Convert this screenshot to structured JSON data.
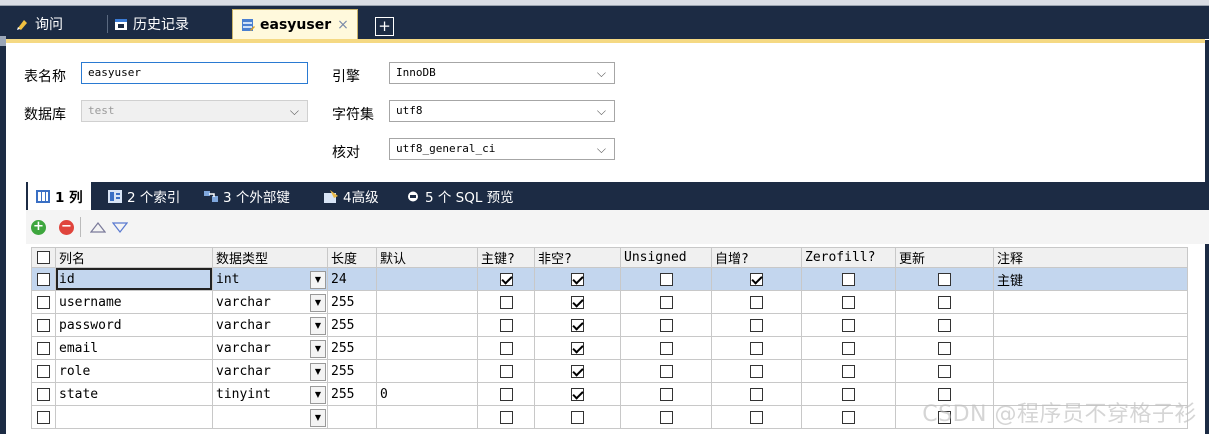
{
  "tabs": [
    {
      "label": "询问",
      "icon": "query-icon"
    },
    {
      "label": "历史记录",
      "icon": "history-icon"
    },
    {
      "label": "easyuser",
      "icon": "table-design-icon",
      "close": "×"
    }
  ],
  "tab_add": "+",
  "form": {
    "table_name_label": "表名称",
    "table_name_value": "easyuser",
    "database_label": "数据库",
    "database_value": "test",
    "engine_label": "引擎",
    "engine_value": "InnoDB",
    "charset_label": "字符集",
    "charset_value": "utf8",
    "collation_label": "核对",
    "collation_value": "utf8_general_ci"
  },
  "subtabs": [
    {
      "label": "1 列",
      "icon": "columns-icon"
    },
    {
      "label": "2 个索引",
      "icon": "index-icon"
    },
    {
      "label": "3 个外部键",
      "icon": "foreign-key-icon"
    },
    {
      "label": "4高级",
      "icon": "advanced-icon"
    },
    {
      "label": "5 个 SQL 预览",
      "icon": "sql-preview-icon"
    }
  ],
  "grid": {
    "headers": [
      "列名",
      "数据类型",
      "长度",
      "默认",
      "主键?",
      "非空?",
      "Unsigned",
      "自增?",
      "Zerofill?",
      "更新",
      "注释"
    ],
    "rows": [
      {
        "name": "id",
        "type": "int",
        "length": "24",
        "default": "",
        "pk": true,
        "notnull": true,
        "unsigned": false,
        "autoinc": true,
        "zerofill": false,
        "update": false,
        "comment": "主键"
      },
      {
        "name": "username",
        "type": "varchar",
        "length": "255",
        "default": "",
        "pk": false,
        "notnull": true,
        "unsigned": false,
        "autoinc": false,
        "zerofill": false,
        "update": false,
        "comment": ""
      },
      {
        "name": "password",
        "type": "varchar",
        "length": "255",
        "default": "",
        "pk": false,
        "notnull": true,
        "unsigned": false,
        "autoinc": false,
        "zerofill": false,
        "update": false,
        "comment": ""
      },
      {
        "name": "email",
        "type": "varchar",
        "length": "255",
        "default": "",
        "pk": false,
        "notnull": true,
        "unsigned": false,
        "autoinc": false,
        "zerofill": false,
        "update": false,
        "comment": ""
      },
      {
        "name": "role",
        "type": "varchar",
        "length": "255",
        "default": "",
        "pk": false,
        "notnull": true,
        "unsigned": false,
        "autoinc": false,
        "zerofill": false,
        "update": false,
        "comment": ""
      },
      {
        "name": "state",
        "type": "tinyint",
        "length": "255",
        "default": "0",
        "pk": false,
        "notnull": true,
        "unsigned": false,
        "autoinc": false,
        "zerofill": false,
        "update": false,
        "comment": ""
      },
      {
        "name": "",
        "type": "",
        "length": "",
        "default": "",
        "pk": false,
        "notnull": false,
        "unsigned": false,
        "autoinc": false,
        "zerofill": false,
        "update": false,
        "comment": ""
      }
    ]
  },
  "watermark": "CSDN @程序员不穿格子衫",
  "colors": {
    "tabbar": "#1c2b44",
    "accent": "#f5d983",
    "selected_row": "#c3d6ee"
  }
}
